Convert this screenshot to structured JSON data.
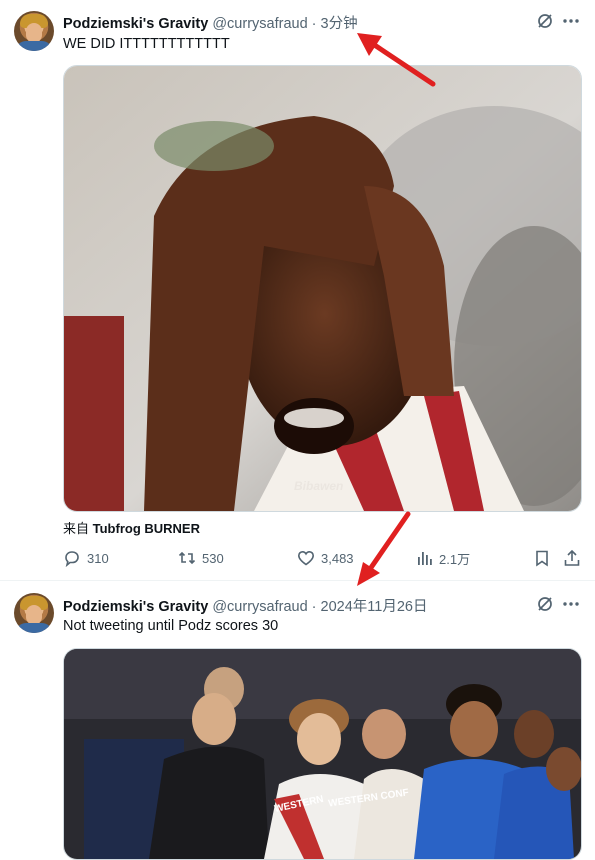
{
  "tweets": [
    {
      "author_name": "Podziemski's Gravity",
      "handle": "@currysafraud",
      "separator": "·",
      "time": "3分钟",
      "text": "WE DID ITTTTTTTTTTTT",
      "media_watermark": "Bibawen",
      "attribution_prefix": "来自",
      "attribution_source": "Tubfrog BURNER",
      "stats": {
        "replies": "310",
        "reposts": "530",
        "likes": "3,483",
        "views": "2.1万"
      }
    },
    {
      "author_name": "Podziemski's Gravity",
      "handle": "@currysafraud",
      "separator": "·",
      "time": "2024年11月26日",
      "text": "Not tweeting until Podz scores 30",
      "media_jersey_text_left": "WESTERN",
      "media_jersey_text_right": "WESTERN CONF"
    }
  ],
  "icons": {
    "grok": "grok-icon",
    "more": "more-icon",
    "reply": "reply-icon",
    "repost": "repost-icon",
    "like": "heart-icon",
    "views": "views-icon",
    "bookmark": "bookmark-icon",
    "share": "share-icon"
  },
  "colors": {
    "text_primary": "#0f1419",
    "text_secondary": "#536471",
    "annotation_arrow": "#e02020"
  }
}
